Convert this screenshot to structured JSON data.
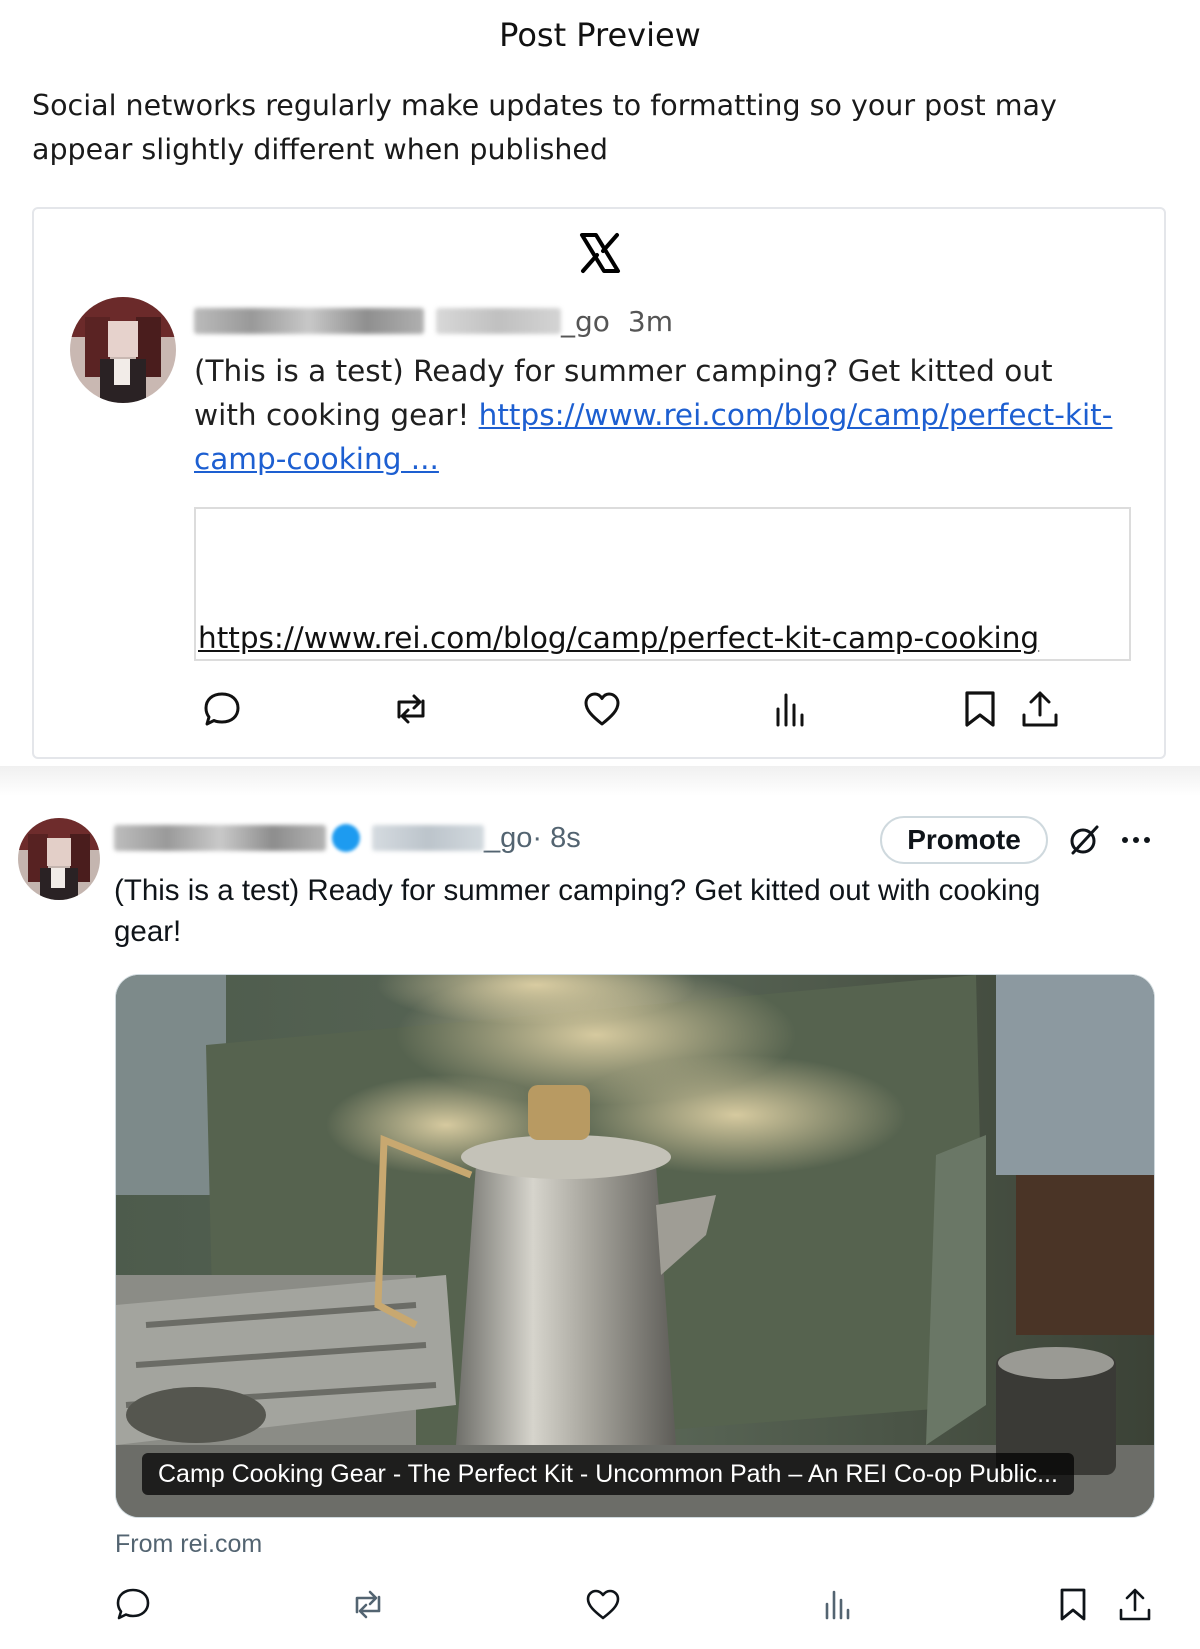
{
  "preview": {
    "title": "Post Preview",
    "description": "Social networks regularly make updates to formatting so your post may appear slightly different when published",
    "network_icon": "x-logo-icon",
    "handle_suffix": "_go",
    "time": "3m",
    "text": "(This is a test) Ready for summer camping? Get kitted out with cooking gear! ",
    "link_text": " https://www.rei.com/blog/camp/perfect-kit-camp-cooking ...",
    "link_card_url": "https://www.rei.com/blog/camp/perfect-kit-camp-cooking",
    "actions": [
      "reply-icon",
      "repost-icon",
      "like-icon",
      "views-icon",
      "bookmark-icon",
      "share-icon"
    ]
  },
  "post": {
    "handle_suffix": "_go",
    "time": " · 8s",
    "promote_label": "Promote",
    "text": "(This is a test) Ready for summer camping? Get kitted out with cooking gear!",
    "card_caption": "Camp Cooking Gear - The Perfect Kit - Uncommon Path – An REI Co-op Public...",
    "from_domain": "From rei.com",
    "verified_color": "#1d9bf0",
    "actions": [
      "reply-icon",
      "repost-icon",
      "like-icon",
      "views-icon",
      "bookmark-icon",
      "share-icon"
    ]
  },
  "colors": {
    "link": "#1d5fd1",
    "muted": "#536471",
    "border": "#cfd9de"
  }
}
